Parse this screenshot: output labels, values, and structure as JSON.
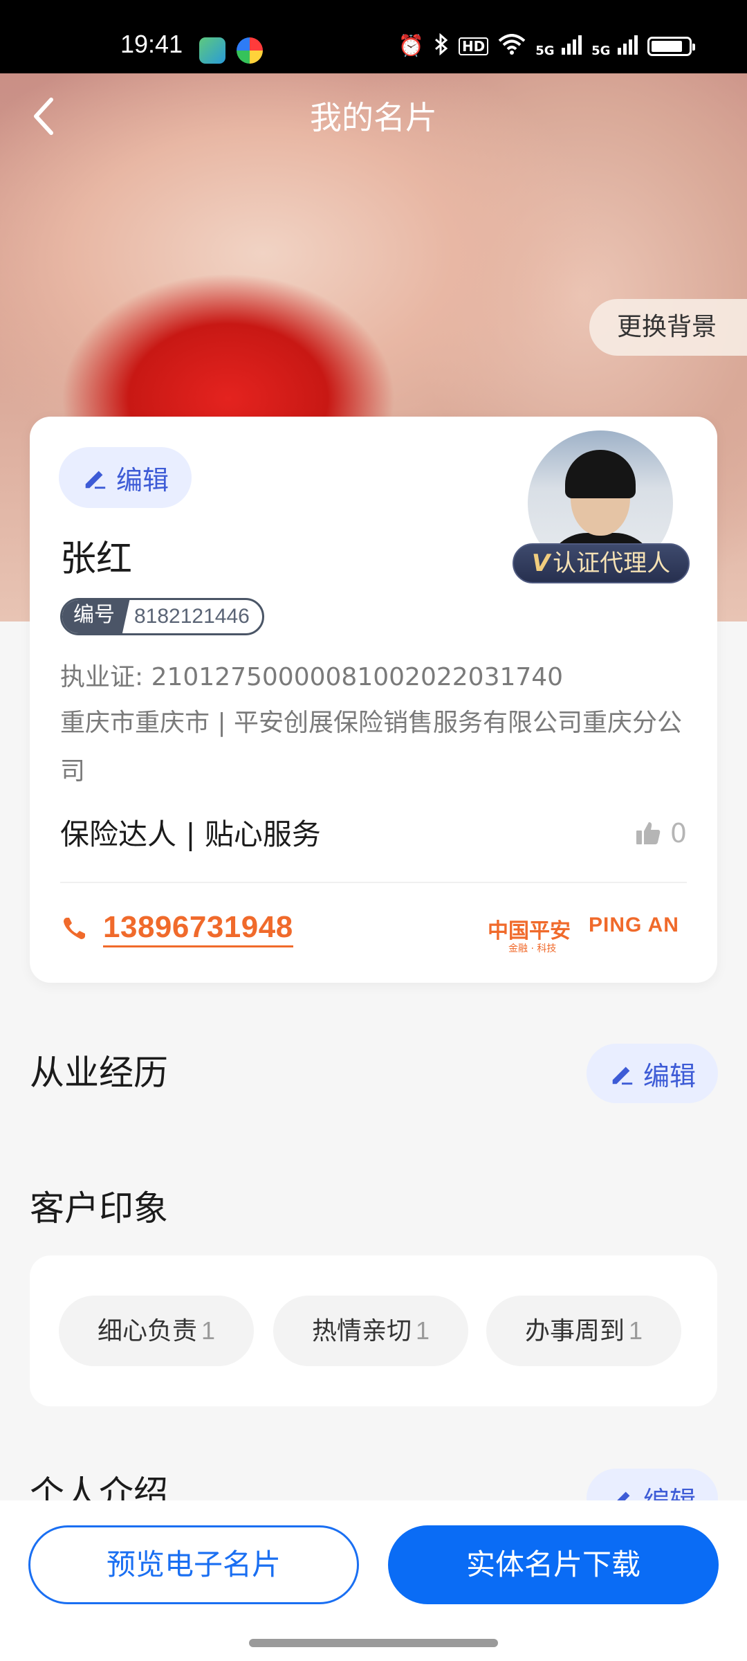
{
  "status_bar": {
    "time": "19:41",
    "icons": [
      "app-icon-1",
      "app-icon-2",
      "alarm-icon",
      "bluetooth-icon",
      "hd-voice-icon",
      "wifi-icon",
      "signal-5g-icon",
      "signal-5g-icon",
      "battery-icon"
    ],
    "hd_label": "HD",
    "sig1_label": "5G",
    "sig2_label": "5G"
  },
  "header": {
    "title": "我的名片",
    "change_background": "更换背景"
  },
  "card": {
    "edit_label": "编辑",
    "name": "张红",
    "id_label": "编号",
    "id_number": "8182121446",
    "license": "执业证: 21012750000081002022031740",
    "company": "重庆市重庆市 | 平安创展保险销售服务有限公司重庆分公司",
    "tagline": "保险达人 | 贴心服务",
    "likes": "0",
    "phone": "13896731948",
    "verified_mark": "V",
    "verified_text": "认证代理人",
    "logo_cn": "中国平安",
    "logo_en": "PING AN",
    "logo_sub": "金融 · 科技"
  },
  "experience": {
    "title": "从业经历",
    "edit_label": "编辑"
  },
  "impressions": {
    "title": "客户印象",
    "tags": [
      {
        "label": "细心负责",
        "count": "1"
      },
      {
        "label": "热情亲切",
        "count": "1"
      },
      {
        "label": "办事周到",
        "count": "1"
      }
    ]
  },
  "intro": {
    "title": "个人介绍",
    "edit_label": "编辑"
  },
  "bottom": {
    "preview_label": "预览电子名片",
    "download_label": "实体名片下载"
  },
  "colors": {
    "primary_blue": "#0a6cf5",
    "edit_blue": "#3d5bd6",
    "phone_orange": "#f06a2b"
  }
}
